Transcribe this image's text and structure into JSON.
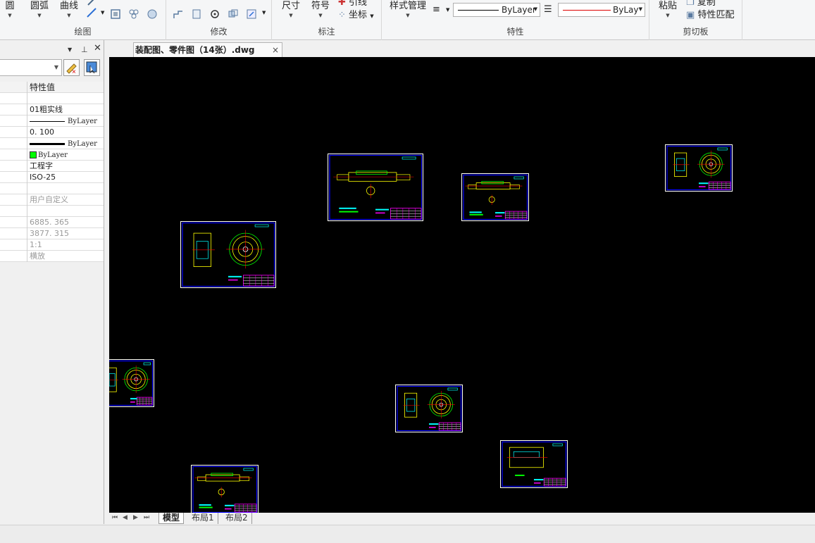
{
  "ribbon": {
    "draw_group": {
      "title": "绘图",
      "circle_label": "圆",
      "arc_label": "圆弧",
      "curve_label": "曲线"
    },
    "modify_group": {
      "title": "修改"
    },
    "annotate_group": {
      "title": "标注",
      "dimension_label": "尺寸",
      "symbol_label": "符号",
      "leader_label": "引线",
      "coordinate_label": "坐标"
    },
    "properties_group": {
      "title": "特性",
      "style_manager_label": "样式管理",
      "linetype_value": "ByLayer",
      "color_value": "ByLay"
    },
    "clipboard_group": {
      "title": "剪切板",
      "paste_label": "粘贴",
      "copy_label": "复制",
      "match_properties_label": "特性匹配"
    }
  },
  "properties_panel": {
    "header_value_label": "特性值",
    "rows": [
      {
        "key": "",
        "value": ""
      },
      {
        "key": "",
        "value": "01粗实线"
      },
      {
        "key": "",
        "value": "ByLayer",
        "kind": "linetype"
      },
      {
        "key": "",
        "value": "0. 100"
      },
      {
        "key": "",
        "value": "ByLayer",
        "kind": "lineweight"
      },
      {
        "key": "",
        "value": "ByLayer",
        "kind": "color",
        "color": "#00ff00"
      },
      {
        "key": "",
        "value": "工程字"
      },
      {
        "key": "",
        "value": "ISO-25"
      },
      {
        "key": "",
        "value": ""
      },
      {
        "key": "",
        "value": "用户自定义",
        "dim": true
      },
      {
        "key": "",
        "value": ""
      },
      {
        "key": "",
        "value": "6885. 365",
        "dim": true
      },
      {
        "key": "",
        "value": "3877. 315",
        "dim": true
      },
      {
        "key": "",
        "value": "1:1",
        "dim": true
      },
      {
        "key": "",
        "value": "横放",
        "dim": true
      }
    ]
  },
  "document": {
    "tab_title": "装配图、零件图（14张）.dwg",
    "close_glyph": "×"
  },
  "canvas": {
    "background": "#000000",
    "sheet_count_visible": 9
  },
  "layout_tabs": {
    "tabs": [
      "模型",
      "布局1",
      "布局2"
    ],
    "active": "模型"
  },
  "colors": {
    "frame": "#ffffff",
    "border": "#0000ff",
    "cyan": "#00ffff",
    "yellow": "#ffff00",
    "magenta": "#ff00ff",
    "red": "#ff0000",
    "green": "#00ff00"
  }
}
